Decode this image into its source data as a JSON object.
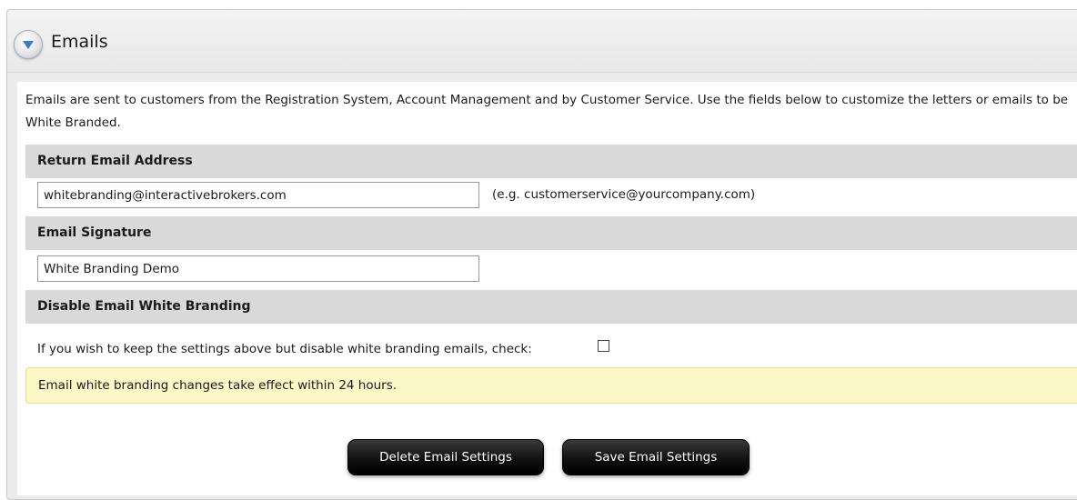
{
  "section": {
    "title": "Emails",
    "collapse_icon": "chevron-down-icon",
    "intro": "Emails are sent to customers from the Registration System, Account Management and by Customer Service. Use the fields below to customize the letters or emails to be White Branded."
  },
  "return_email": {
    "heading": "Return Email Address",
    "value": "whitebranding@interactivebrokers.com",
    "hint": "(e.g. customerservice@yourcompany.com)"
  },
  "signature": {
    "heading": "Email Signature",
    "value": "White Branding Demo"
  },
  "disable": {
    "heading": "Disable Email White Branding",
    "label": "If you wish to keep the settings above but disable white branding emails, check:",
    "checked": false
  },
  "notice": "Email white branding changes take effect within 24 hours.",
  "buttons": {
    "delete_label": "Delete Email Settings",
    "save_label": "Save Email Settings"
  },
  "colors": {
    "header_bg": "#d9d9d9",
    "notice_bg": "#fbf7c6",
    "button_bg": "#111111",
    "icon_accent": "#3a7bc8"
  }
}
